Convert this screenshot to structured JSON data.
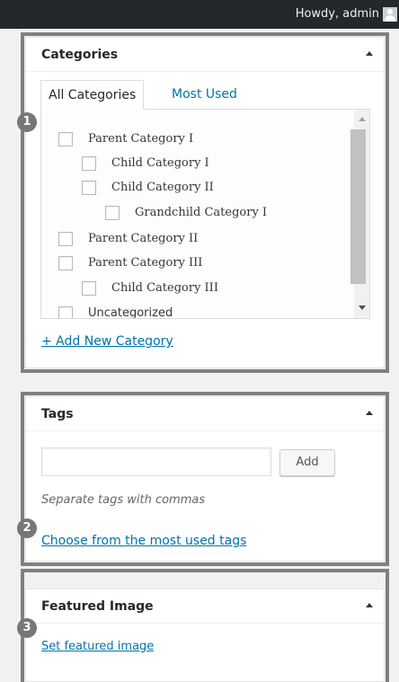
{
  "admin_bar": {
    "greeting": "Howdy, admin"
  },
  "categories_box": {
    "badge": "1",
    "title": "Categories",
    "tabs": [
      {
        "label": "All Categories",
        "active": true
      },
      {
        "label": "Most Used",
        "active": false
      }
    ],
    "items": [
      {
        "label": "Parent Category I",
        "level": 0,
        "checked": false
      },
      {
        "label": "Child Category I",
        "level": 1,
        "checked": false
      },
      {
        "label": "Child Category II",
        "level": 1,
        "checked": false
      },
      {
        "label": "Grandchild Category I",
        "level": 2,
        "checked": false
      },
      {
        "label": "Parent Category II",
        "level": 0,
        "checked": false
      },
      {
        "label": "Parent Category III",
        "level": 0,
        "checked": false
      },
      {
        "label": "Child Category III",
        "level": 1,
        "checked": false
      },
      {
        "label": "Uncategorized",
        "level": 0,
        "checked": false
      }
    ],
    "add_link": "+ Add New Category"
  },
  "tags_box": {
    "badge": "2",
    "title": "Tags",
    "input_value": "",
    "add_button": "Add",
    "hint": "Separate tags with commas",
    "choose_link": "Choose from the most used tags"
  },
  "featured_box": {
    "badge": "3",
    "title": "Featured Image",
    "set_link": "Set featured image"
  }
}
